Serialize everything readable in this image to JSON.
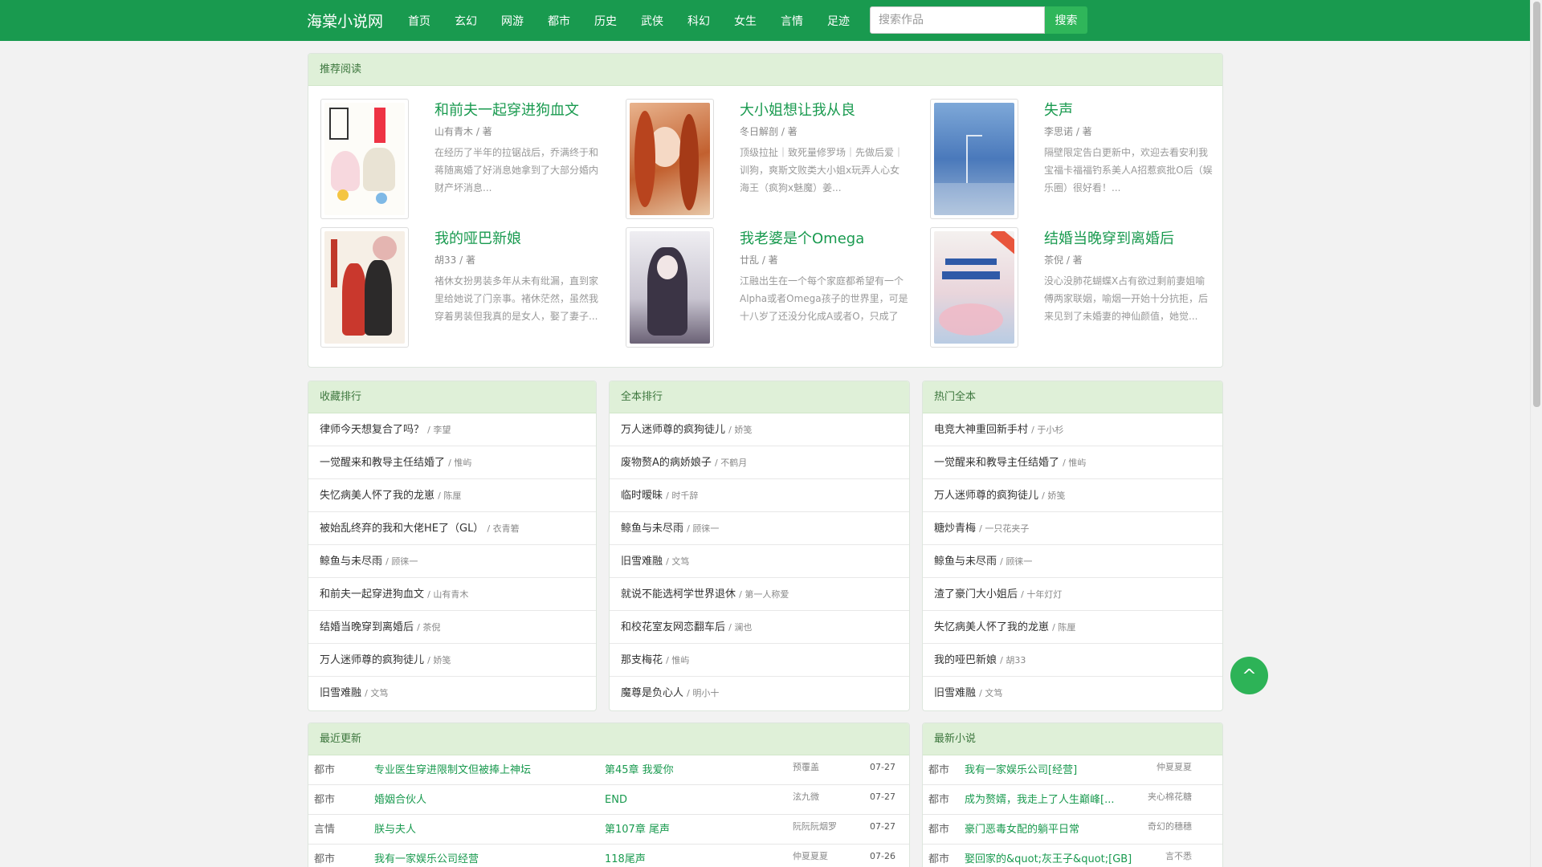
{
  "nav": {
    "brand": "海棠小说网",
    "links": [
      "首页",
      "玄幻",
      "网游",
      "都市",
      "历史",
      "武侠",
      "科幻",
      "女生",
      "言情",
      "足迹"
    ],
    "search_placeholder": "搜索作品",
    "search_button": "搜索"
  },
  "recommend": {
    "heading": "推荐阅读",
    "books": [
      {
        "title": "和前夫一起穿进狗血文",
        "author": "山有青木 / 著",
        "desc": "在经历了半年的拉锯战后，乔满终于和蒋随离婚了好消息她拿到了大部分婚内财产坏消息..."
      },
      {
        "title": "大小姐想让我从良",
        "author": "冬日解剖 / 著",
        "desc": "顶级拉扯｜致死量修罗场｜先做后爱｜训狗，爽斯文败类大小姐x玩弄人心女海王（疯狗x魅魔）姜..."
      },
      {
        "title": "失声",
        "author": "李思诺 / 著",
        "desc": "隔壁限定告白更新中，欢迎去看安利我宝福卡福福钓系美人A招惹疯批O后（娱乐圈）很好看！..."
      },
      {
        "title": "我的哑巴新娘",
        "author": "胡33 / 著",
        "desc": "褚休女扮男装多年从未有纰漏，直到家里给她说了门亲事。褚休茫然，虽然我穿着男装但我真的是女人，娶了妻子..."
      },
      {
        "title": "我老婆是个Omega",
        "author": "廿乱 / 著",
        "desc": "江融出生在一个每个家庭都希望有一个Alpha或者Omega孩子的世界里，可是十八岁了还没分化成A或者O，只成了"
      },
      {
        "title": "结婚当晚穿到离婚后",
        "author": "茶倪 / 著",
        "desc": "没心没肺花蝴蝶X占有欲过剩前妻姐喻傅两家联姻，喻烟一开始十分抗拒，后来见到了未婚妻的神仙颜值，她觉..."
      }
    ]
  },
  "collect_rank": {
    "heading": "收藏排行",
    "items": [
      {
        "title": "律师今天想复合了吗？",
        "author": "/ 李望"
      },
      {
        "title": "一觉醒来和教导主任结婚了",
        "author": "/ 惟屿"
      },
      {
        "title": "失忆病美人怀了我的龙崽",
        "author": "/ 陈厘"
      },
      {
        "title": "被始乱终弃的我和大佬HE了（GL）",
        "author": "/ 衣青箬"
      },
      {
        "title": "鲸鱼与未尽雨",
        "author": "/ 顾徕一"
      },
      {
        "title": "和前夫一起穿进狗血文",
        "author": "/ 山有青木"
      },
      {
        "title": "结婚当晚穿到离婚后",
        "author": "/ 茶倪"
      },
      {
        "title": "万人迷师尊的疯狗徒儿",
        "author": "/ 娇笺"
      },
      {
        "title": "旧雪难融",
        "author": "/ 文笃"
      }
    ]
  },
  "full_rank": {
    "heading": "全本排行",
    "items": [
      {
        "title": "万人迷师尊的疯狗徒儿",
        "author": "/ 娇笺"
      },
      {
        "title": "废物赘A的病娇娘子",
        "author": "/ 不鹤月"
      },
      {
        "title": "临时暧昧",
        "author": "/ 时千辞"
      },
      {
        "title": "鲸鱼与未尽雨",
        "author": "/ 顾徕一"
      },
      {
        "title": "旧雪难融",
        "author": "/ 文笃"
      },
      {
        "title": "就说不能选柯学世界退休",
        "author": "/ 第一人称爱"
      },
      {
        "title": "和校花室友网恋翻车后",
        "author": "/ 澜也"
      },
      {
        "title": "那支梅花",
        "author": "/ 惟屿"
      },
      {
        "title": "魔尊是负心人",
        "author": "/ 明小十"
      }
    ]
  },
  "hot_full": {
    "heading": "热门全本",
    "items": [
      {
        "title": "电竞大神重回新手村",
        "author": "/ 于小杉"
      },
      {
        "title": "一觉醒来和教导主任结婚了",
        "author": "/ 惟屿"
      },
      {
        "title": "万人迷师尊的疯狗徒儿",
        "author": "/ 娇笺"
      },
      {
        "title": "糖炒青梅",
        "author": "/ 一只花夹子"
      },
      {
        "title": "鲸鱼与未尽雨",
        "author": "/ 顾徕一"
      },
      {
        "title": "渣了豪门大小姐后",
        "author": "/ 十年灯灯"
      },
      {
        "title": "失忆病美人怀了我的龙崽",
        "author": "/ 陈厘"
      },
      {
        "title": "我的哑巴新娘",
        "author": "/ 胡33"
      },
      {
        "title": "旧雪难融",
        "author": "/ 文笃"
      }
    ]
  },
  "recent_updates": {
    "heading": "最近更新",
    "rows": [
      {
        "category": "都市",
        "book": "专业医生穿进限制文但被捧上神坛",
        "chapter": "第45章 我爱你",
        "author": "预覆盖",
        "date": "07-27"
      },
      {
        "category": "都市",
        "book": "婚姻合伙人",
        "chapter": "END",
        "author": "泫九微",
        "date": "07-27"
      },
      {
        "category": "言情",
        "book": "朕与夫人",
        "chapter": "第107章 尾声",
        "author": "阮阮阮烟罗",
        "date": "07-27"
      },
      {
        "category": "都市",
        "book": "我有一家娱乐公司经营",
        "chapter": "118尾声",
        "author": "仲夏夏夏",
        "date": "07-26"
      }
    ]
  },
  "new_novels": {
    "heading": "最新小说",
    "rows": [
      {
        "category": "都市",
        "book": "我有一家娱乐公司[经营]",
        "author": "仲夏夏夏"
      },
      {
        "category": "都市",
        "book": "成为赘婿，我走上了人生巅峰[...",
        "author": "夹心棉花糖"
      },
      {
        "category": "都市",
        "book": "豪门恶毒女配的躺平日常",
        "author": "奇幻的穗穗"
      },
      {
        "category": "都市",
        "book": "娶回家的&quot;灰王子&quot;[GB]",
        "author": "言不悉"
      }
    ]
  },
  "back_to_top": "^"
}
